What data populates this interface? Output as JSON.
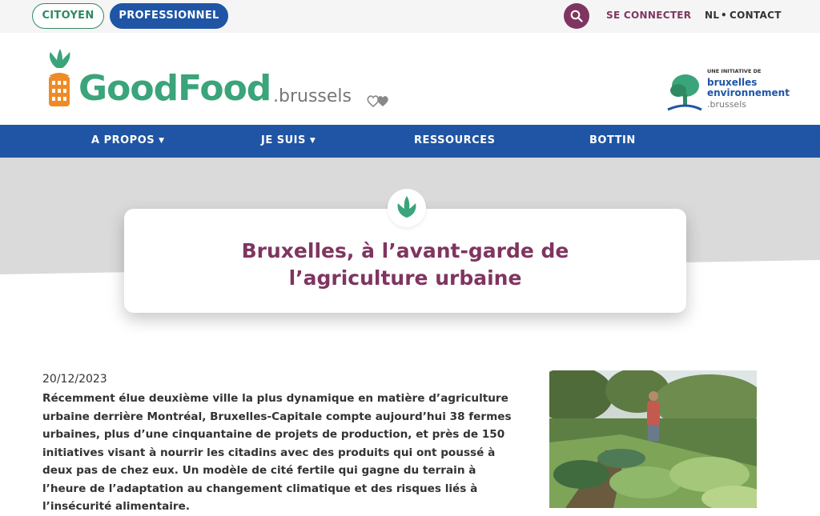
{
  "topbar": {
    "citoyen": "CITOYEN",
    "professionnel": "PROFESSIONNEL",
    "search_icon": "search-icon",
    "login": "SE CONNECTER",
    "lang": "NL",
    "separator": "•",
    "contact": "CONTACT"
  },
  "header": {
    "logo_text": "GoodFood",
    "logo_suffix": ".brussels",
    "partner": {
      "small": "UNE INITIATIVE DE",
      "line1": "bruxelles",
      "line2": "environnement",
      "line3": ".brussels"
    }
  },
  "nav": {
    "items": [
      {
        "label": "A PROPOS",
        "chevron": "chevron-down-icon"
      },
      {
        "label": "JE SUIS",
        "chevron": "chevron-down-icon"
      },
      {
        "label": "RESSOURCES"
      },
      {
        "label": "BOTTIN"
      }
    ]
  },
  "hero": {
    "title_line1": "Bruxelles, à l’avant-garde de",
    "title_line2": "l’agriculture urbaine"
  },
  "article": {
    "date": "20/12/2023",
    "intro": "Récemment élue deuxième ville la plus dynamique en matière d’agriculture urbaine derrière Montréal, Bruxelles-Capitale compte aujourd’hui 38 fermes urbaines, plus d’une cinquantaine de projets de production, et près de 150 initiatives visant à nourrir les citadins avec des produits qui ont poussé à deux pas de chez eux. Un modèle de cité fertile qui gagne du terrain à l’heure de l’adaptation au changement climatique et des risques liés à l’insécurité alimentaire."
  },
  "colors": {
    "green": "#3aa47a",
    "blue": "#1f55a4",
    "plum": "#7f3560",
    "orange": "#f08a24",
    "hero_gray": "#dadada"
  }
}
